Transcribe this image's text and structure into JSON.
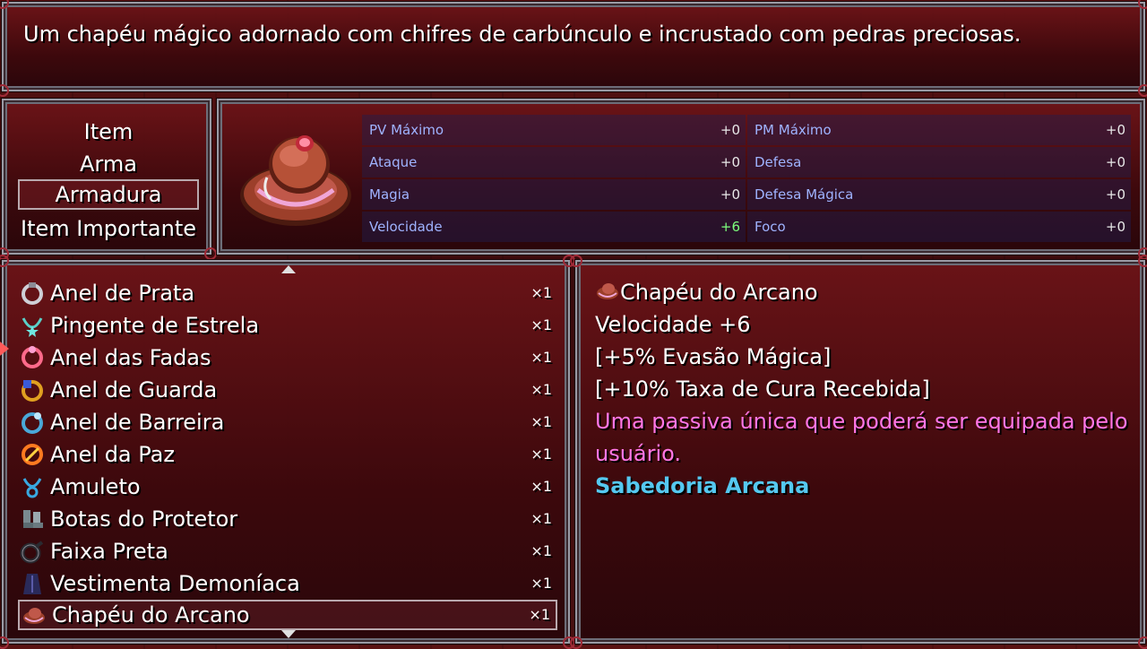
{
  "help": {
    "text": "Um chapéu mágico adornado com chifres de carbúnculo e incrustado com pedras preciosas."
  },
  "categories": [
    {
      "label": "Item"
    },
    {
      "label": "Arma"
    },
    {
      "label": "Armadura",
      "selected": true
    },
    {
      "label": "Item Importante"
    }
  ],
  "stats": {
    "left": [
      {
        "label": "PV Máximo",
        "value": "+0"
      },
      {
        "label": "Ataque",
        "value": "+0"
      },
      {
        "label": "Magia",
        "value": "+0"
      },
      {
        "label": "Velocidade",
        "value": "+6"
      }
    ],
    "right": [
      {
        "label": "PM Máximo",
        "value": "+0"
      },
      {
        "label": "Defesa",
        "value": "+0"
      },
      {
        "label": "Defesa Mágica",
        "value": "+0"
      },
      {
        "label": "Foco",
        "value": "+0"
      }
    ],
    "colors": {
      "label": "#9fb3ff",
      "increase": "#7dff7d"
    }
  },
  "items": [
    {
      "name": "Anel de Prata",
      "qty": "×1",
      "icon": "silver-ring-icon"
    },
    {
      "name": "Pingente de Estrela",
      "qty": "×1",
      "icon": "star-pendant-icon"
    },
    {
      "name": "Anel das Fadas",
      "qty": "×1",
      "icon": "fairy-ring-icon"
    },
    {
      "name": "Anel de Guarda",
      "qty": "×1",
      "icon": "guard-ring-icon"
    },
    {
      "name": "Anel de Barreira",
      "qty": "×1",
      "icon": "barrier-ring-icon"
    },
    {
      "name": "Anel da Paz",
      "qty": "×1",
      "icon": "peace-ring-icon"
    },
    {
      "name": "Amuleto",
      "qty": "×1",
      "icon": "amulet-icon"
    },
    {
      "name": "Botas do Protetor",
      "qty": "×1",
      "icon": "boots-icon"
    },
    {
      "name": "Faixa Preta",
      "qty": "×1",
      "icon": "black-belt-icon"
    },
    {
      "name": "Vestimenta Demoníaca",
      "qty": "×1",
      "icon": "demon-robe-icon"
    },
    {
      "name": "Chapéu do Arcano",
      "qty": "×1",
      "icon": "arcane-hat-icon",
      "selected": true
    }
  ],
  "detail": {
    "name": "Chapéu do Arcano",
    "stat": "Velocidade +6",
    "effect1": "[+5% Evasão Mágica]",
    "effect2": "[+10% Taxa de Cura Recebida]",
    "passive_line1": "Uma passiva única que poderá ser equipada pelo",
    "passive_line2": "usuário.",
    "passive_name": "Sabedoria Arcana",
    "colors": {
      "passive_text": "#ff77e6",
      "passive_name": "#55c8f0"
    }
  }
}
